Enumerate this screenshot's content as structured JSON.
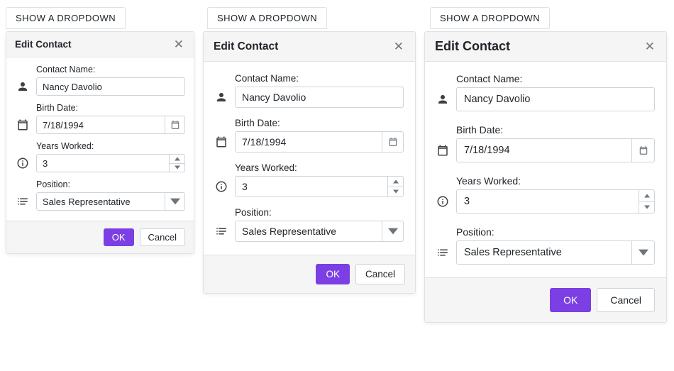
{
  "dropdownLabel": "SHOW A DROPDOWN",
  "popup": {
    "title": "Edit Contact",
    "labels": {
      "contactName": "Contact Name:",
      "birthDate": "Birth Date:",
      "yearsWorked": "Years Worked:",
      "position": "Position:"
    },
    "values": {
      "contactName": "Nancy Davolio",
      "birthDate": "7/18/1994",
      "yearsWorked": "3",
      "position": "Sales Representative"
    },
    "buttons": {
      "ok": "OK",
      "cancel": "Cancel"
    }
  }
}
